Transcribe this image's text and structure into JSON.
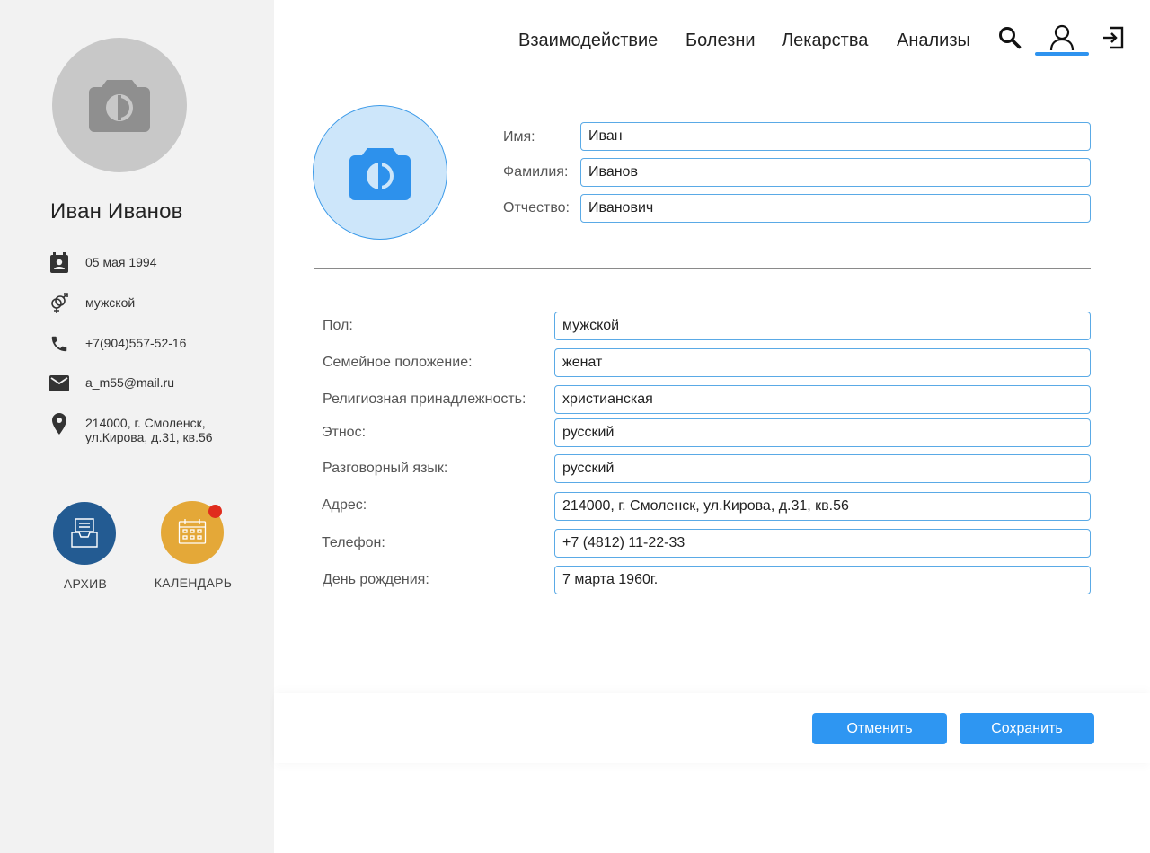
{
  "sidebar": {
    "name": "Иван Иванов",
    "birthdate": "05 мая 1994",
    "gender": "мужской",
    "phone": "+7(904)557-52-16",
    "email": "a_m55@mail.ru",
    "address": "214000, г. Смоленск,\nул.Кирова, д.31, кв.56",
    "archive_label": "АРХИВ",
    "calendar_label": "КАЛЕНДАРЬ",
    "icons": [
      "camera-icon",
      "calendar-contact-icon",
      "gender-icon",
      "phone-icon",
      "mail-icon",
      "location-pin-icon",
      "archive-tray-icon",
      "calendar-icon"
    ]
  },
  "nav": {
    "links": [
      "Взаимодействие",
      "Болезни",
      "Лекарства",
      "Анализы"
    ],
    "icons": [
      "search-icon",
      "user-icon",
      "logout-icon"
    ],
    "active": "user-icon"
  },
  "form": {
    "first_name": {
      "label": "Имя:",
      "value": "Иван"
    },
    "last_name": {
      "label": "Фамилия:",
      "value": "Иванов"
    },
    "patronymic": {
      "label": "Отчество:",
      "value": "Иванович"
    },
    "fields": [
      {
        "label": "Пол:",
        "value": "мужской"
      },
      {
        "label": "Семейное положение:",
        "value": "женат"
      },
      {
        "label": "Религиозная принадлежность:",
        "value": "христианская"
      },
      {
        "label": "Этнос:",
        "value": "русский"
      },
      {
        "label": "Разговорный язык:",
        "value": "русский"
      },
      {
        "label": "Адрес:",
        "value": "214000, г. Смоленск, ул.Кирова, д.31, кв.56"
      },
      {
        "label": "Телефон:",
        "value": "+7 (4812) 11-22-33"
      },
      {
        "label": "День рождения:",
        "value": "7 марта 1960г."
      }
    ]
  },
  "actions": {
    "cancel": "Отменить",
    "save": "Сохранить"
  },
  "colors": {
    "accent": "#2e96f2",
    "archive": "#235b92",
    "calendar": "#e4a838",
    "notification": "#e02c1d",
    "sidebar_bg": "#f2f2f2"
  }
}
